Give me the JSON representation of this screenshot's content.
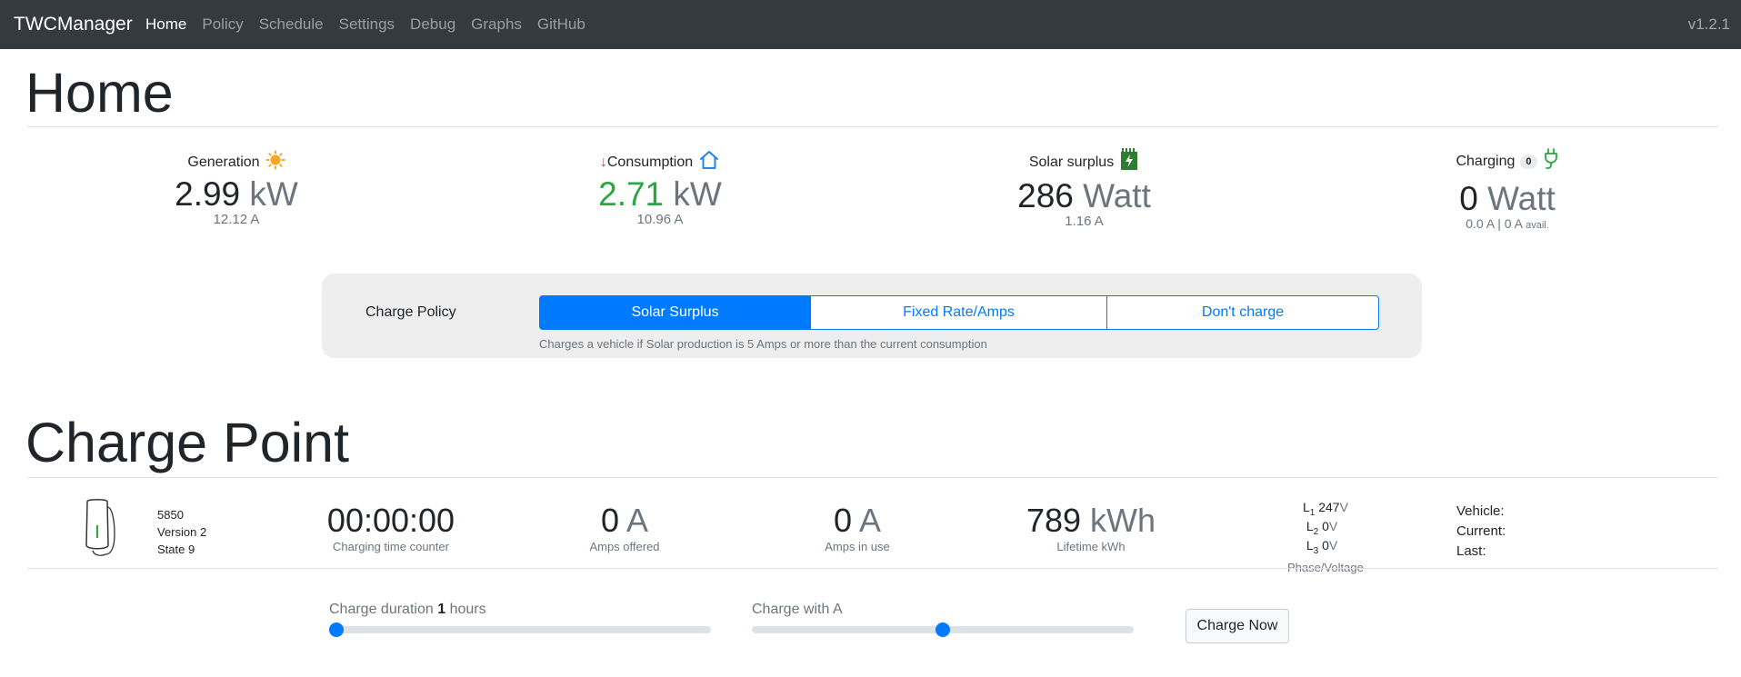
{
  "navbar": {
    "brand": "TWCManager",
    "items": [
      {
        "label": "Home",
        "active": true
      },
      {
        "label": "Policy",
        "active": false
      },
      {
        "label": "Schedule",
        "active": false
      },
      {
        "label": "Settings",
        "active": false
      },
      {
        "label": "Debug",
        "active": false
      },
      {
        "label": "Graphs",
        "active": false
      },
      {
        "label": "GitHub",
        "active": false
      }
    ],
    "version": "v1.2.1"
  },
  "home": {
    "title": "Home",
    "generation": {
      "label": "Generation",
      "value": "2.99",
      "unit": "kW",
      "amps": "12.12 A",
      "icon": "sun-icon"
    },
    "consumption": {
      "arrow": "↓",
      "label": "Consumption",
      "value": "2.71",
      "unit": "kW",
      "amps": "10.96 A",
      "icon": "house-icon"
    },
    "surplus": {
      "label": "Solar surplus",
      "value": "286",
      "unit": "Watt",
      "amps": "1.16 A",
      "icon": "solar-panel-icon"
    },
    "charging": {
      "label": "Charging",
      "badge": "0",
      "value": "0",
      "unit": "Watt",
      "amps": "0.0 A | 0 A",
      "avail": "avail.",
      "icon": "plug-icon"
    }
  },
  "policy": {
    "label": "Charge Policy",
    "options": [
      "Solar Surplus",
      "Fixed Rate/Amps",
      "Don't charge"
    ],
    "selected": "Solar Surplus",
    "help": "Charges a vehicle if Solar production is 5 Amps or more than the current consumption"
  },
  "charge_point": {
    "title": "Charge Point",
    "device": {
      "id": "5850",
      "version": "Version 2",
      "state": "State 9"
    },
    "timer": {
      "value": "00:00:00",
      "caption": "Charging time counter"
    },
    "amps_offered": {
      "value": "0",
      "unit": "A",
      "caption": "Amps offered"
    },
    "amps_in_use": {
      "value": "0",
      "unit": "A",
      "caption": "Amps in use"
    },
    "lifetime": {
      "value": "789",
      "unit": "kWh",
      "caption": "Lifetime kWh"
    },
    "phases": [
      {
        "l": "L",
        "n": "1",
        "v": "247",
        "u": "V"
      },
      {
        "l": "L",
        "n": "2",
        "v": "0",
        "u": "V"
      },
      {
        "l": "L",
        "n": "3",
        "v": "0",
        "u": "V"
      }
    ],
    "phase_caption": "Phase/Voltage",
    "vehicle": {
      "vehicle_label": "Vehicle:",
      "current_label": "Current:",
      "last_label": "Last:"
    }
  },
  "controls": {
    "duration_pre": "Charge duration",
    "duration_value": "1",
    "duration_post": "hours",
    "duration_fraction": 0.0,
    "amps_label": "Charge with A",
    "amps_fraction": 0.5,
    "charge_now": "Charge Now"
  },
  "colors": {
    "accent": "#007bff",
    "navbar": "#343a40",
    "green": "#28a745",
    "sun": "#f5a623"
  }
}
